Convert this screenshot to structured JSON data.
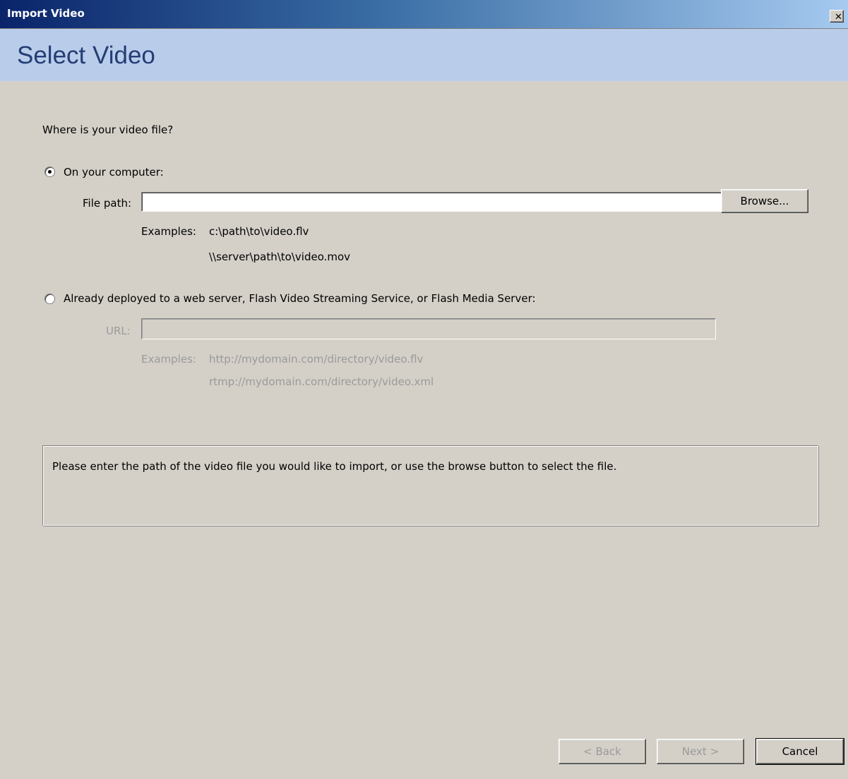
{
  "window": {
    "title": "Import Video",
    "close_glyph": "✕"
  },
  "header": {
    "title": "Select Video"
  },
  "form": {
    "question": "Where is your video file?",
    "option_computer": {
      "label": "On your computer:",
      "selected": true,
      "file_path_label": "File path:",
      "file_path_value": "",
      "browse_label": "Browse...",
      "examples_label": "Examples:",
      "example_1": "c:\\path\\to\\video.flv",
      "example_2": "\\\\server\\path\\to\\video.mov"
    },
    "option_deployed": {
      "label": "Already deployed to a web server, Flash Video Streaming Service, or Flash Media Server:",
      "selected": false,
      "url_label": "URL:",
      "url_value": "",
      "examples_label": "Examples:",
      "example_1": "http://mydomain.com/directory/video.flv",
      "example_2": "rtmp://mydomain.com/directory/video.xml"
    }
  },
  "info": {
    "text": "Please enter the path of the video file you would like to import, or use the browse button to select the file."
  },
  "footer": {
    "back_label": "< Back",
    "next_label": "Next >",
    "cancel_label": "Cancel"
  },
  "colors": {
    "title_gradient_start": "#0a246a",
    "title_gradient_end": "#a6caf0",
    "header_band": "#b9cdea",
    "header_title": "#243d75",
    "dialog_bg": "#d4d0c8",
    "disabled_text": "#9a9a9a"
  }
}
